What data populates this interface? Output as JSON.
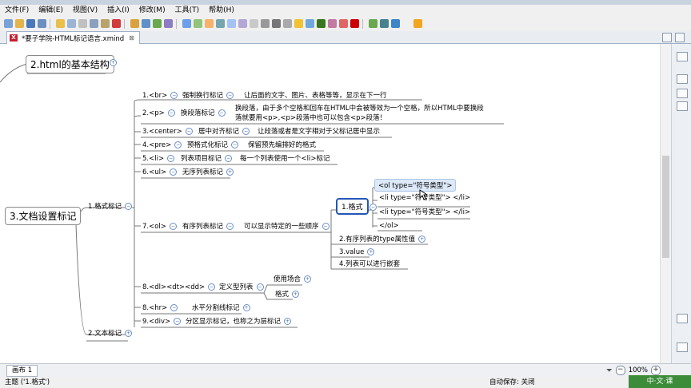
{
  "menu": [
    "文件(F)",
    "编辑(E)",
    "视图(V)",
    "插入(I)",
    "修改(M)",
    "工具(T)",
    "帮助(H)"
  ],
  "tab": {
    "label": "*要子学院-HTML标记语言.xmind",
    "close": "⊠"
  },
  "map": {
    "html_structure": "2.html的基本结构",
    "doc_tags": "3.文档设置标记",
    "format_tags": "1.格式标记",
    "text_tags": "2.文本标记",
    "br": {
      "tag": "1.<br>",
      "name": "强制换行标记",
      "desc": "让后面的文字、图片、表格等等，显示在下一行"
    },
    "p": {
      "tag": "2.<p>",
      "name": "换段落标记",
      "desc1": "换段落，由于多个空格和回车在HTML中会被等效为一个空格，所以HTML中要换段",
      "desc2": "落就要用<p>,<p>段落中也可以包含<p>段落！"
    },
    "center": {
      "tag": "3.<center>",
      "name": "居中对齐标记",
      "desc": "让段落或者是文字相对于父标记居中显示"
    },
    "pre": {
      "tag": "4.<pre>",
      "name": "预格式化标记",
      "desc": "保留预先编排好的格式"
    },
    "li": {
      "tag": "5.<li>",
      "name": "列表项目标记",
      "desc": "每一个列表使用一个<li>标记"
    },
    "ul": {
      "tag": "6.<ul>",
      "name": "无序列表标记"
    },
    "ol": {
      "tag": "7.<ol>",
      "name": "有序列表标记",
      "desc": "可以显示特定的一些顺序"
    },
    "ol_format": "1.格式",
    "ol_lines": [
      "<ol type=\"符号类型\">",
      "<li type=\"符号类型\"> </li>",
      "<li type=\"符号类型\"> </li>",
      "</ol>"
    ],
    "ol_type": "2.有序列表的type属性值",
    "ol_value": "3.value",
    "ol_nest": "4.列表可以进行嵌套",
    "dl": {
      "tag": "8.<dl><dt><dd>",
      "name": "定义型列表",
      "use": "使用场合",
      "format": "格式"
    },
    "hr": {
      "tag": "8.<hr>",
      "name": "水平分割线标记"
    },
    "div": {
      "tag": "9.<div>",
      "name": "分区显示标记，也称之为层标记"
    }
  },
  "sheet": {
    "label": "画布 1",
    "zoom": "100%"
  },
  "status": {
    "left": "主题 ('1.格式')",
    "right": "自动保存: 关闭"
  },
  "brand": "中·文·课"
}
